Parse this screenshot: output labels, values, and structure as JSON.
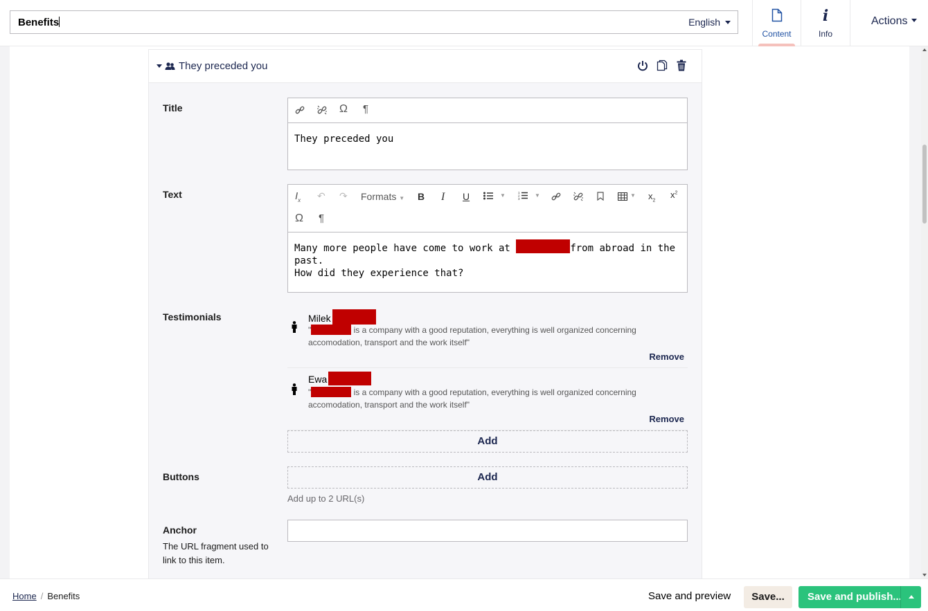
{
  "header": {
    "name_value": "Benefits",
    "language": "English",
    "tabs": [
      {
        "label": "Content",
        "icon": "document-icon",
        "active": true
      },
      {
        "label": "Info",
        "icon": "info-icon",
        "active": false
      }
    ],
    "actions_label": "Actions"
  },
  "block": {
    "title": "They preceded you",
    "icons": [
      "power-icon",
      "copy-icon",
      "trash-icon"
    ]
  },
  "properties": {
    "title": {
      "label": "Title",
      "value": "They preceded you"
    },
    "text": {
      "label": "Text",
      "formats_label": "Formats",
      "paragraph_part1": "Many more people have come to work at",
      "paragraph_part2": "from abroad in the past.",
      "paragraph_line2": "How did they experience that?"
    },
    "testimonials": {
      "label": "Testimonials",
      "items": [
        {
          "name": "Milek",
          "quote_open": "\"",
          "quote_text": "is a company with a good reputation, everything is well organized concerning",
          "quote_line2": "accomodation, transport and the work itself\"",
          "remove_label": "Remove"
        },
        {
          "name": "Ewa",
          "quote_open": "\"",
          "quote_text": "is a company with a good reputation, everything is well organized concerning",
          "quote_line2": "accomodation, transport and the work itself\"",
          "remove_label": "Remove"
        }
      ],
      "add_label": "Add"
    },
    "buttons": {
      "label": "Buttons",
      "add_label": "Add",
      "hint": "Add up to 2 URL(s)"
    },
    "anchor": {
      "label": "Anchor",
      "description": "The URL fragment used to link to this item.",
      "value": ""
    }
  },
  "footer": {
    "breadcrumb": [
      {
        "label": "Home"
      },
      {
        "label": "Benefits"
      }
    ],
    "save_preview_label": "Save and preview",
    "save_label": "Save...",
    "publish_label": "Save and publish..."
  },
  "colors": {
    "primary_text": "#1b264f",
    "publish_green": "#2bc37c",
    "save_bg": "#f3ece4",
    "active_tab_indicator": "#f5c1bc",
    "redaction": "#c00000"
  }
}
